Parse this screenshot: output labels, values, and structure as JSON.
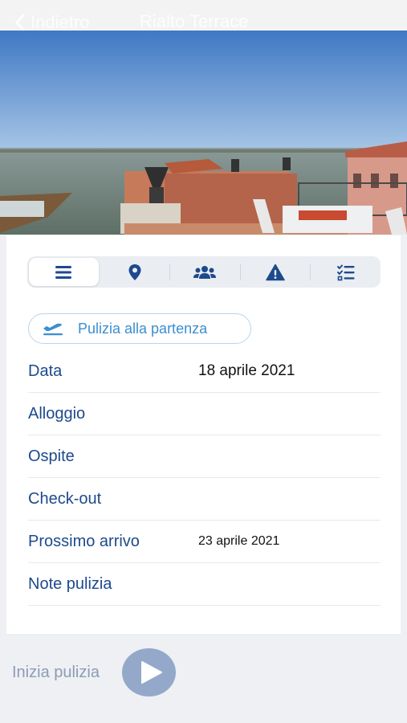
{
  "nav": {
    "back_label": "Indietro",
    "title": "Rialto Terrace"
  },
  "tabs": [
    {
      "name": "details",
      "icon": "list-icon",
      "active": true
    },
    {
      "name": "location",
      "icon": "map-pin-icon",
      "active": false
    },
    {
      "name": "guests",
      "icon": "users-icon",
      "active": false
    },
    {
      "name": "issues",
      "icon": "warning-icon",
      "active": false
    },
    {
      "name": "checklist",
      "icon": "checklist-icon",
      "active": false
    }
  ],
  "chip": {
    "icon": "plane-departure-icon",
    "label": "Pulizia alla partenza"
  },
  "details": {
    "date_label": "Data",
    "date_value": "18 aprile 2021",
    "lodging_label": "Alloggio",
    "guest_label": "Ospite",
    "checkout_label": "Check-out",
    "next_arrival_label": "Prossimo arrivo",
    "next_arrival_value": "23 aprile 2021",
    "notes_label": "Note pulizia"
  },
  "footer": {
    "start_label": "Inizia pulizia",
    "play_icon": "play-icon"
  },
  "colors": {
    "accent": "#1d4a8c",
    "chip_text": "#3b8fd0",
    "play_button": "#94a9ca"
  }
}
